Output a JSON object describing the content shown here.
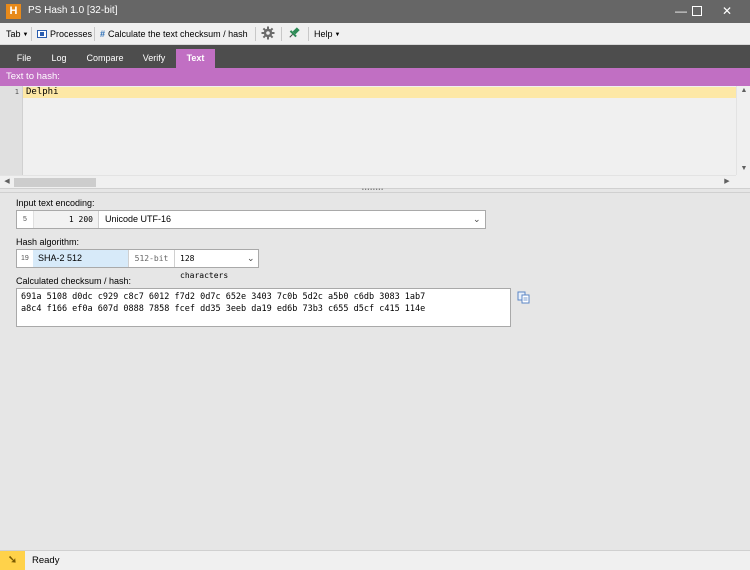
{
  "window": {
    "icon_letter": "H",
    "title": "PS Hash 1.0  [32-bit]",
    "minimize_glyph": "—",
    "maximize_glyph": "☐",
    "close_glyph": "✕"
  },
  "toolbar": {
    "tab_menu": "Tab",
    "processes": "Processes",
    "calculate": "Calculate the text checksum / hash",
    "settings_icon": "gear-icon",
    "pin_icon": "pin-icon",
    "help_menu": "Help"
  },
  "tabs": [
    {
      "label": "File"
    },
    {
      "label": "Log"
    },
    {
      "label": "Compare"
    },
    {
      "label": "Verify"
    },
    {
      "label": "Text"
    }
  ],
  "active_tab": "Text",
  "editor": {
    "header": "Text to hash:",
    "line_number": "1",
    "content": "Delphi"
  },
  "encoding": {
    "label": "Input text encoding:",
    "index": "5",
    "codepage": "1 200",
    "value": "Unicode UTF-16"
  },
  "algorithm": {
    "label": "Hash algorithm:",
    "index": "19",
    "name": "SHA-2 512",
    "bits": "512-bit",
    "length": "128 characters"
  },
  "result": {
    "label": "Calculated checksum / hash:",
    "line1": "691a 5108 d0dc c929 c8c7 6012 f7d2 0d7c 652e 3403 7c0b 5d2c a5b0 c6db 3083 1ab7",
    "line2": "a8c4 f166 ef0a 607d 0888 7858 fcef dd35 3eeb da19 ed6b 73b3 c655 d5cf c415 114e"
  },
  "status": {
    "text": "Ready"
  },
  "colors": {
    "accent": "#c16fc3",
    "titlebar": "#666666",
    "tabbar": "#4d4d4d",
    "current_line": "#fde8a6",
    "algo_highlight": "#d7eaf9",
    "status_icon": "#ffd24a"
  }
}
